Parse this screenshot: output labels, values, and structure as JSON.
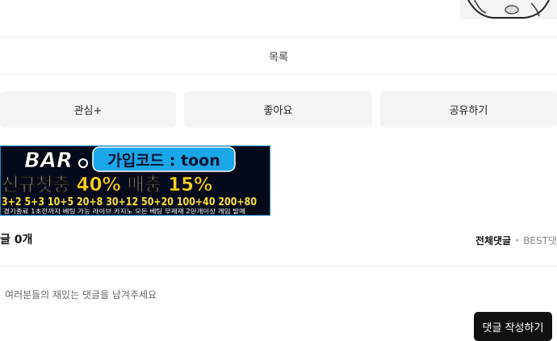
{
  "list_label": "목록",
  "actions": {
    "interest": "관심+",
    "like": "좋아요",
    "share": "공유하기"
  },
  "banner": {
    "logo": "BAR",
    "code_label": "가입코드 : toon",
    "headline_prefix": "신규첫충 ",
    "headline_pct1": "40%",
    "headline_mid": " 매충 ",
    "headline_pct2": "15%",
    "bonuses": "3+2 5+3 10+5 20+8 30+12 50+20 100+40 200+80",
    "fine_print": "경기종료 1초전까지 베팅 가능 라이브 카지노 모든 베팅 무제재 2만개이상 게임 발매"
  },
  "comments": {
    "title": "글 0개",
    "sort_all": "전체댓글",
    "sort_best": "BEST댓",
    "placeholder": "여러분들의 재밌는 댓글을 남겨주세요",
    "write_button": "댓글 작성하기"
  }
}
